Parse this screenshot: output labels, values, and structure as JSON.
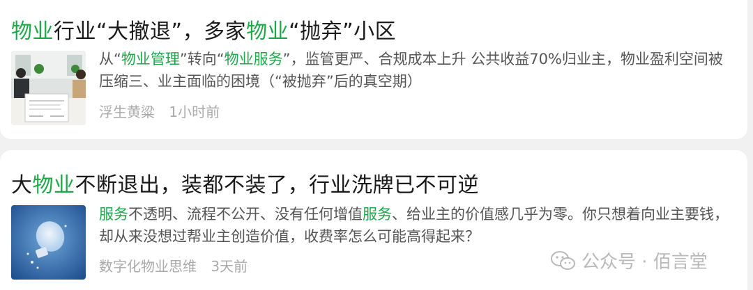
{
  "articles": [
    {
      "title_parts": [
        {
          "text": "物业",
          "hl": true
        },
        {
          "text": "行业“大撤退”，多家",
          "hl": false
        },
        {
          "text": "物业",
          "hl": true
        },
        {
          "text": "“抛弃”小区",
          "hl": false
        }
      ],
      "summary_parts": [
        {
          "text": "从“",
          "hl": false
        },
        {
          "text": "物业管理",
          "hl": true
        },
        {
          "text": "”转向“",
          "hl": false
        },
        {
          "text": "物业服务",
          "hl": true
        },
        {
          "text": "”，监管更严、合规成本上升 公共收益70%归业主，物业盈利空间被压缩三、业主面临的困境（“被抛弃”后的真空期）",
          "hl": false
        }
      ],
      "author": "浮生黄粱",
      "time": "1小时前",
      "thumb_icon": "office-contract-signing-photo"
    },
    {
      "title_parts": [
        {
          "text": "大",
          "hl": false
        },
        {
          "text": "物业",
          "hl": true
        },
        {
          "text": "不断退出，装都不装了，行业洗牌已不可逆",
          "hl": false
        }
      ],
      "summary_parts": [
        {
          "text": "服务",
          "hl": true
        },
        {
          "text": "不透明、流程不公开、没有任何增值",
          "hl": false
        },
        {
          "text": "服务",
          "hl": true
        },
        {
          "text": "、给业主的价值感几乎为零。你只想着向业主要钱，却从来没想过帮业主创造价值，收费率怎么可能高得起来？",
          "hl": false
        }
      ],
      "author": "数字化物业思维",
      "time": "3天前",
      "thumb_icon": "lightbulb-photo"
    }
  ],
  "watermark": {
    "text": "公众号 · 佰言堂",
    "icon": "wechat-icon"
  },
  "colors": {
    "highlight": "#1ea84a",
    "title": "#1a1a1a",
    "summary": "#555555",
    "meta": "#aaaaaa",
    "background": "#f1f1f1"
  }
}
